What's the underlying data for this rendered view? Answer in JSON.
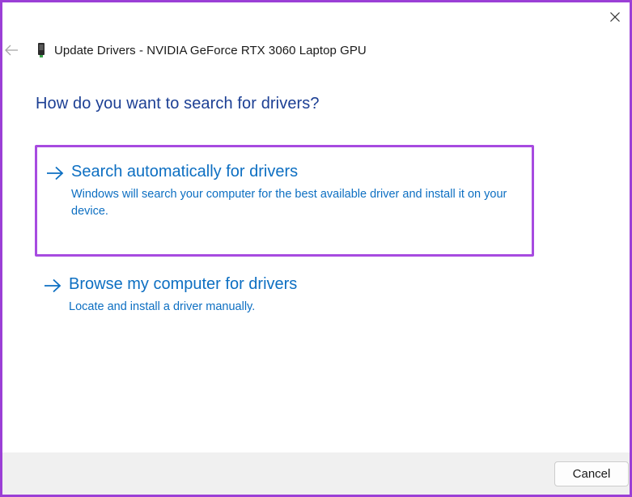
{
  "window": {
    "title": "Update Drivers - NVIDIA GeForce RTX 3060 Laptop GPU",
    "back_icon": "back-arrow-icon",
    "close_icon": "close-icon",
    "device_icon": "graphics-card-icon"
  },
  "main": {
    "heading": "How do you want to search for drivers?",
    "options": [
      {
        "title": "Search automatically for drivers",
        "description": "Windows will search your computer for the best available driver and install it on your device.",
        "icon": "arrow-right-icon",
        "selected": true
      },
      {
        "title": "Browse my computer for drivers",
        "description": "Locate and install a driver manually.",
        "icon": "arrow-right-icon",
        "selected": false
      }
    ]
  },
  "footer": {
    "cancel_label": "Cancel"
  },
  "colors": {
    "highlight_border": "#a74be0",
    "window_border": "#9b3fd6",
    "heading": "#1c3f94",
    "link": "#0d6fc2",
    "footer_bg": "#f0f0f0"
  }
}
